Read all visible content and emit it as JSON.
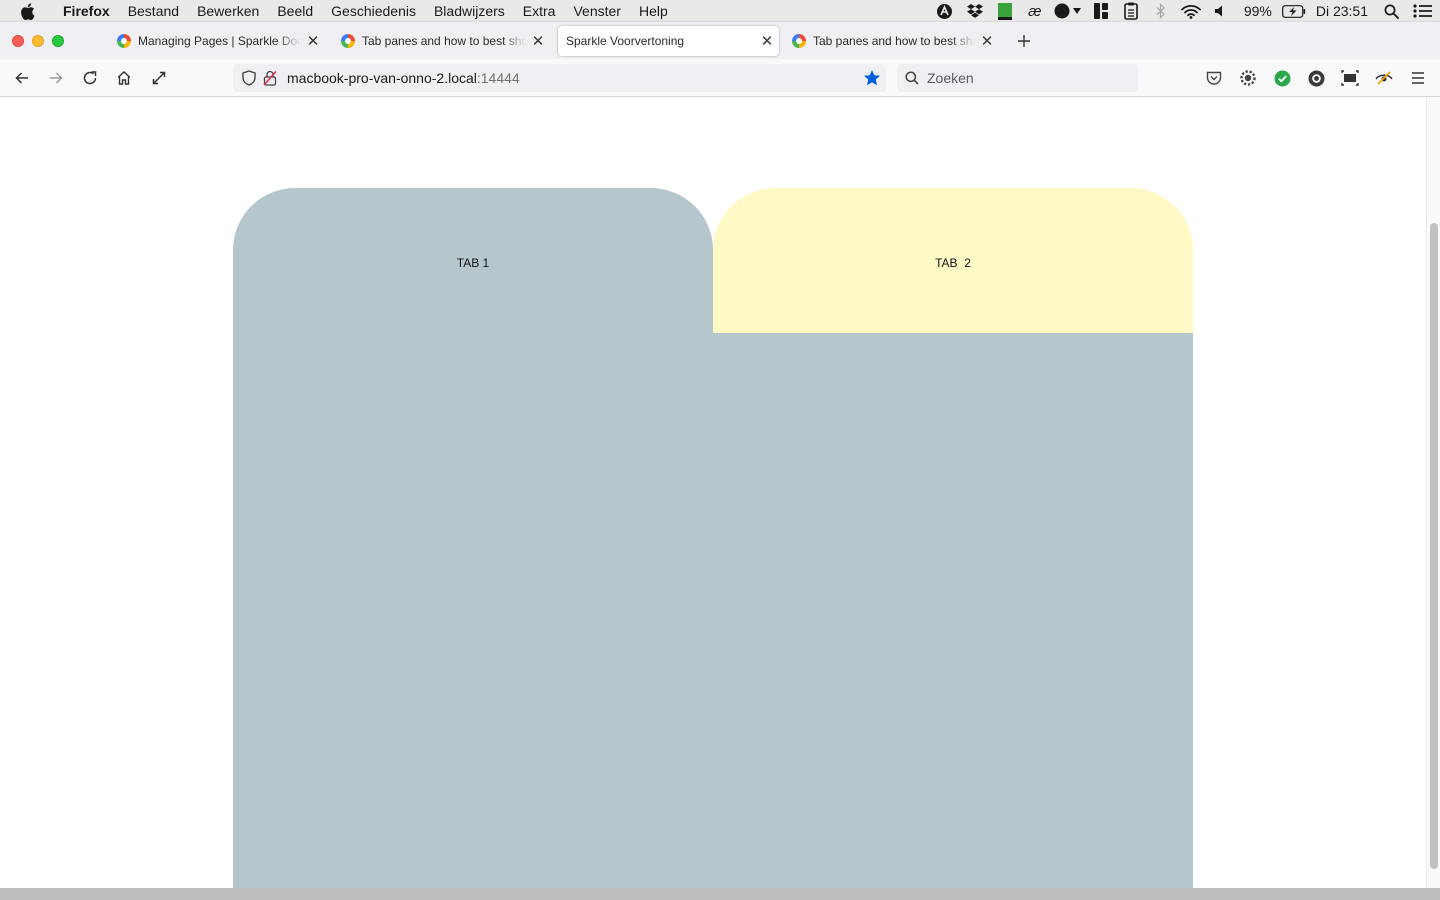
{
  "menubar": {
    "app": "Firefox",
    "items": [
      "Bestand",
      "Bewerken",
      "Beeld",
      "Geschiedenis",
      "Bladwijzers",
      "Extra",
      "Venster",
      "Help"
    ],
    "battery": "99%",
    "clock": "Di 23:51"
  },
  "tabs": [
    {
      "title": "Managing Pages | Sparkle Documentation",
      "active": false
    },
    {
      "title": "Tab panes and how to best show them",
      "active": false
    },
    {
      "title": "Sparkle Voorvertoning",
      "active": true
    },
    {
      "title": "Tab panes and how to best show them",
      "active": false
    }
  ],
  "urlbar": {
    "host": "macbook-pro-van-onno-2.local",
    "port": ":14444"
  },
  "searchbar": {
    "placeholder": "Zoeken"
  },
  "page": {
    "tab1_label": "TAB 1",
    "tab2_label": "TAB  2",
    "colors": {
      "tab1": "#b6c6cd",
      "tab2": "#fffac5"
    }
  },
  "icons": {
    "menubar_status": [
      "avast-icon",
      "dropbox-icon",
      "notes-icon",
      "ae-icon",
      "toggle-icon",
      "grid-icon",
      "clipboard-icon",
      "bluetooth-icon",
      "wifi-icon",
      "volume-icon",
      "battery-icon",
      "spotlight-icon",
      "control-center-icon"
    ],
    "toolbar": [
      "pocket-icon",
      "extension-gear-icon",
      "green-check-icon",
      "circle-o-icon",
      "screenshot-icon",
      "eye-slash-icon",
      "menu-icon"
    ]
  }
}
